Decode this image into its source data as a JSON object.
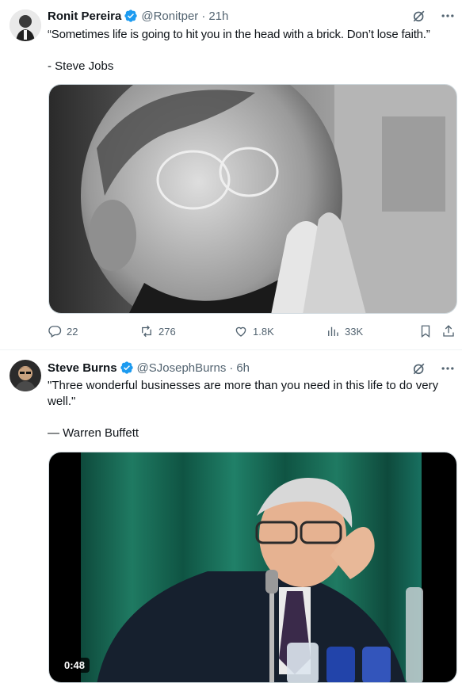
{
  "tweets": [
    {
      "author_name": "Ronit Pereira",
      "author_handle": "@Ronitper",
      "time": "21h",
      "separator": "·",
      "text_line1": "“Sometimes life is going to hit you in the head with a brick. Don’t lose faith.”",
      "text_line2": "- Steve Jobs",
      "replies": "22",
      "reposts": "276",
      "likes": "1.8K",
      "views": "33K",
      "media_alt": "Black and white photo of Steve Jobs"
    },
    {
      "author_name": "Steve Burns",
      "author_handle": "@SJosephBurns",
      "time": "6h",
      "separator": "·",
      "text_line1": "\"Three wonderful businesses are more than you need in this life to do very well.\"",
      "text_line2": "— Warren Buffett",
      "video_duration": "0:48",
      "media_alt": "Video of Warren Buffett speaking at a microphone"
    }
  ],
  "colors": {
    "verified": "#1d9bf0",
    "text_secondary": "#536471",
    "text_primary": "#0f1419",
    "divider": "#eff3f4"
  },
  "icons": [
    "verified-badge-icon",
    "grok-icon",
    "more-icon",
    "reply-icon",
    "repost-icon",
    "like-icon",
    "views-icon",
    "bookmark-icon",
    "share-icon"
  ]
}
